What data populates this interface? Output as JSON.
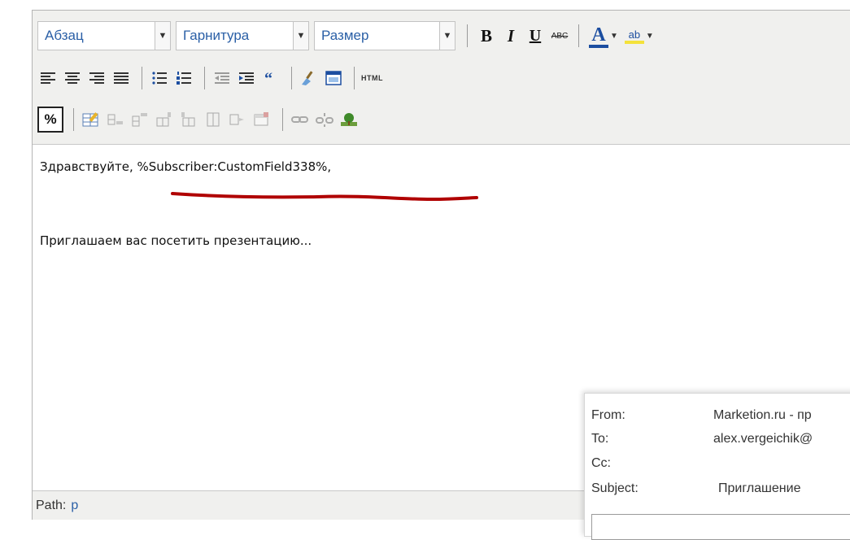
{
  "toolbar": {
    "paragraph_select": "Абзац",
    "font_select": "Гарнитура",
    "size_select": "Размер",
    "bold": "B",
    "italic": "I",
    "underline": "U",
    "strike": "ABC",
    "font_color": "A",
    "highlight": "ab",
    "html": "HTML",
    "placeholder": "%"
  },
  "content": {
    "greeting": "Здравствуйте, %Subscriber:CustomField338%,",
    "body": "Приглашаем вас посетить презентацию..."
  },
  "pathbar": {
    "label": "Path:",
    "value": "p"
  },
  "email_popup": {
    "from_label": "From:",
    "from_value": "Marketion.ru - пр",
    "to_label": "To:",
    "to_value": "alex.vergeichik@",
    "cc_label": "Cc:",
    "cc_value": "",
    "subject_label": "Subject:",
    "subject_value": "Приглашение"
  },
  "colors": {
    "accent_blue": "#1c4ea0",
    "underline_red": "#b00000",
    "highlight_yellow": "#f4e23b"
  }
}
